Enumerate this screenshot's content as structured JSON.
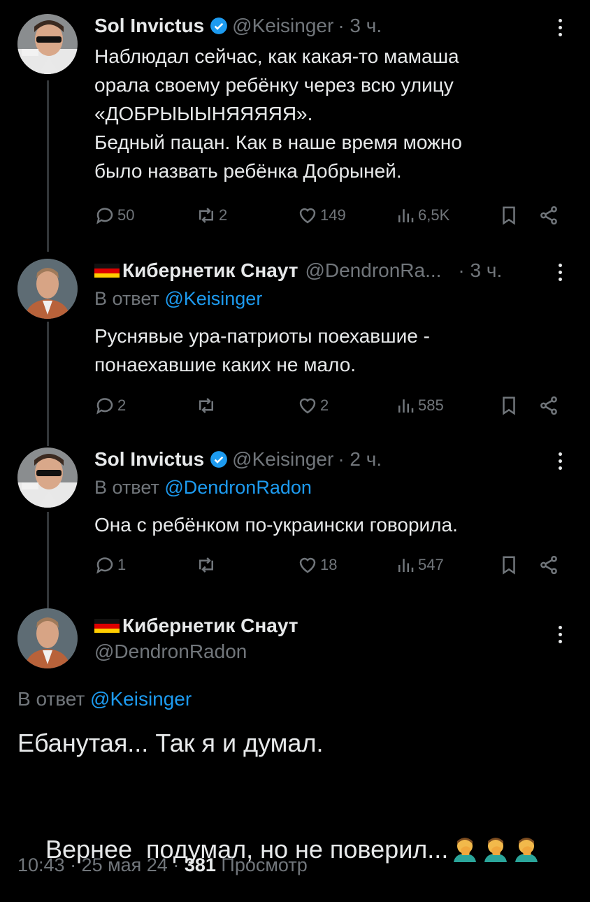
{
  "tweet1": {
    "name": "Sol Invictus",
    "handle": "@Keisinger",
    "time": "· 3 ч.",
    "text": "Наблюдал сейчас, как какая-то мамаша\nорала своему ребёнку через всю улицу\n«ДОБРЫЫЫНЯЯЯЯЯ».\nБедный пацан. Как в наше время можно\nбыло назвать ребёнка Добрыней.",
    "replies": "50",
    "reposts": "2",
    "likes": "149",
    "views": "6,5K"
  },
  "tweet2": {
    "name": "Кибернетик Снаут",
    "handle": "@DendronRa...",
    "time": "· 3 ч.",
    "reply_prefix": "В ответ",
    "reply_to": "@Keisinger",
    "text": "Руснявые ура-патриоты поехавшие -\nпонаехавшие каких не мало.",
    "replies": "2",
    "reposts": "",
    "likes": "2",
    "views": "585"
  },
  "tweet3": {
    "name": "Sol Invictus",
    "handle": "@Keisinger",
    "time": "· 2 ч.",
    "reply_prefix": "В ответ",
    "reply_to": "@DendronRadon",
    "text": "Она с ребёнком по-украински говорила.",
    "replies": "1",
    "reposts": "",
    "likes": "18",
    "views": "547"
  },
  "main": {
    "name": "Кибернетик Снаут",
    "handle": "@DendronRadon",
    "reply_prefix": "В ответ",
    "reply_to": "@Keisinger",
    "line1": "Ебанутая... Так я и думал.",
    "line2": "Вернее  подумал, но не поверил...",
    "time": "10:43 · 25 мая 24 ·",
    "views_count": "381",
    "views_label": "Просмотр"
  },
  "colors": {
    "accent": "#1d9bf0",
    "muted": "#71767b",
    "text": "#e7e9ea",
    "background": "#000000"
  },
  "icons": [
    "verified-badge-icon",
    "more-icon",
    "reply-icon",
    "repost-icon",
    "like-icon",
    "views-icon",
    "bookmark-icon",
    "share-icon",
    "german-flag-icon",
    "face-palm-emoji"
  ]
}
